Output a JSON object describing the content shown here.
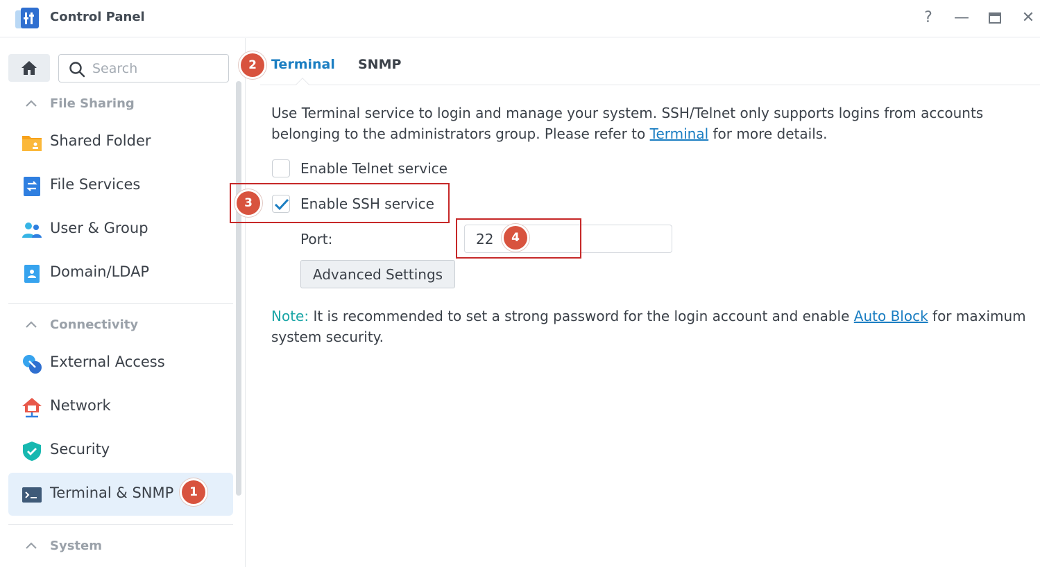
{
  "window": {
    "title": "Control Panel",
    "help_glyph": "?",
    "minimize_glyph": "—",
    "maximize_glyph": "▭",
    "close_glyph": "✕"
  },
  "sidebar": {
    "search_placeholder": "Search",
    "sections": [
      {
        "label": "File Sharing",
        "items": [
          {
            "label": "Shared Folder",
            "icon": "folder-icon"
          },
          {
            "label": "File Services",
            "icon": "file-services-icon"
          },
          {
            "label": "User & Group",
            "icon": "users-icon"
          },
          {
            "label": "Domain/LDAP",
            "icon": "domain-icon"
          }
        ]
      },
      {
        "label": "Connectivity",
        "items": [
          {
            "label": "External Access",
            "icon": "external-access-icon"
          },
          {
            "label": "Network",
            "icon": "network-icon"
          },
          {
            "label": "Security",
            "icon": "shield-icon"
          },
          {
            "label": "Terminal & SNMP",
            "icon": "terminal-icon",
            "selected": true
          }
        ]
      },
      {
        "label": "System",
        "items": []
      }
    ]
  },
  "tabs": [
    {
      "label": "Terminal",
      "active": true
    },
    {
      "label": "SNMP",
      "active": false
    }
  ],
  "terminal": {
    "description_pre": "Use Terminal service to login and manage your system. SSH/Telnet only supports logins from accounts belonging to the administrators group. Please refer to",
    "description_link": "Terminal",
    "description_post": "for more details.",
    "telnet_label": "Enable Telnet service",
    "telnet_checked": false,
    "ssh_label": "Enable SSH service",
    "ssh_checked": true,
    "port_label": "Port:",
    "port_value": "22",
    "advanced_button": "Advanced Settings",
    "note_label": "Note:",
    "note_pre": "It is recommended to set a strong password for the login account and enable",
    "note_link": "Auto Block",
    "note_post": "for maximum system security."
  },
  "annotations": {
    "badge_1": "1",
    "badge_2": "2",
    "badge_3": "3",
    "badge_4": "4"
  },
  "colors": {
    "accent": "#1b7ec2",
    "badge": "#d8533e",
    "highlight_box": "#c62828",
    "note_label": "#19a5a6",
    "selected_bg": "#e5f0fb"
  }
}
